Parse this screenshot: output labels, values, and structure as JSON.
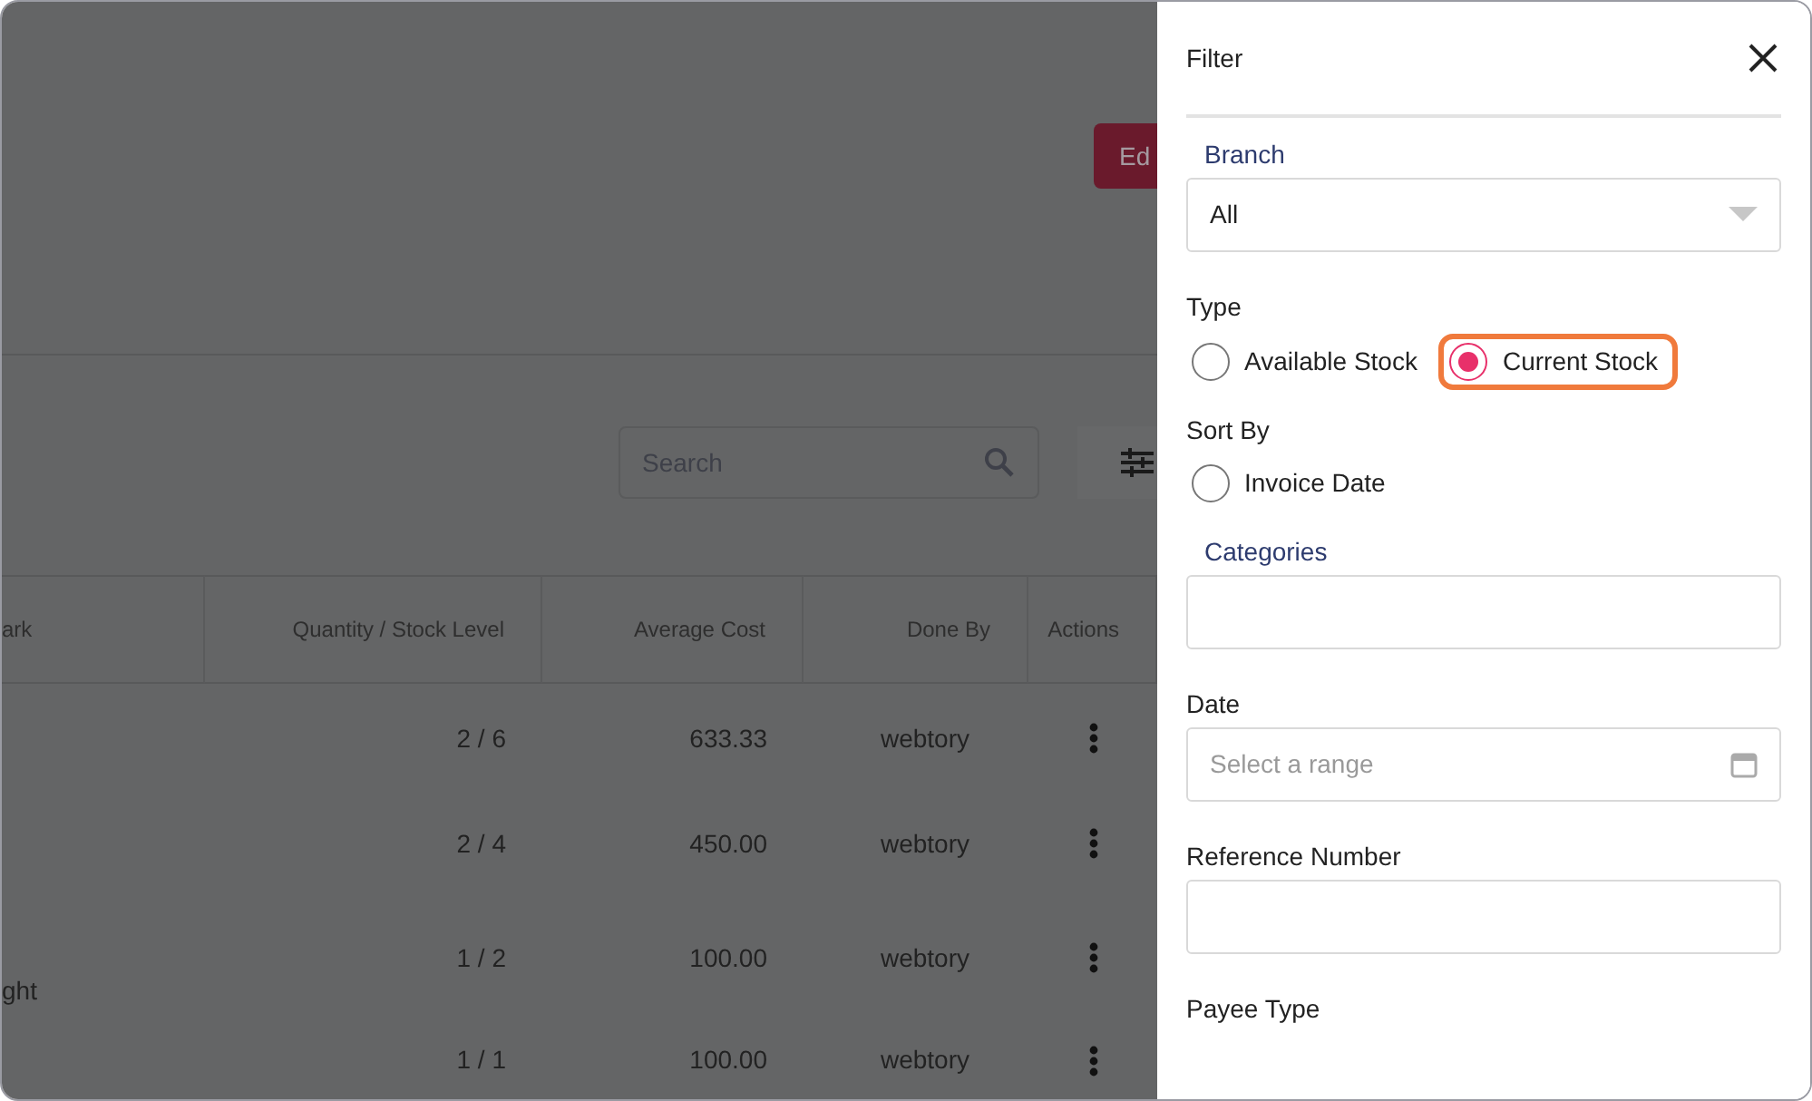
{
  "page": {
    "header_button": "Ed",
    "search": {
      "placeholder": "Search"
    },
    "table": {
      "columns": [
        "ark",
        "Quantity / Stock Level",
        "Average Cost",
        "Done By",
        "Actions"
      ],
      "rows": [
        {
          "column_1": "",
          "quantity": "2 / 6",
          "average_cost": "633.33",
          "done_by": "webtory"
        },
        {
          "column_1": "",
          "quantity": "2 / 4",
          "average_cost": "450.00",
          "done_by": "webtory"
        },
        {
          "column_1": "ght",
          "quantity": "1 / 2",
          "average_cost": "100.00",
          "done_by": "webtory"
        },
        {
          "column_1": "",
          "quantity": "1 / 1",
          "average_cost": "100.00",
          "done_by": "webtory"
        }
      ]
    }
  },
  "filter_panel": {
    "title": "Filter",
    "fields": [
      {
        "kind": "select",
        "label": "Branch",
        "accent_label": true,
        "value": "All"
      },
      {
        "kind": "radio",
        "label": "Type",
        "accent_label": false,
        "options": [
          {
            "label": "Available Stock",
            "selected": false,
            "highlighted": false
          },
          {
            "label": "Current Stock",
            "selected": true,
            "highlighted": true
          }
        ]
      },
      {
        "kind": "radio",
        "label": "Sort By",
        "accent_label": false,
        "options": [
          {
            "label": "Invoice Date",
            "selected": false,
            "highlighted": false
          }
        ]
      },
      {
        "kind": "input",
        "label": "Categories",
        "accent_label": true
      },
      {
        "kind": "date",
        "label": "Date",
        "accent_label": false,
        "placeholder": "Select a range"
      },
      {
        "kind": "input",
        "label": "Reference Number",
        "accent_label": false
      },
      {
        "kind": "label",
        "label": "Payee Type",
        "accent_label": false
      }
    ]
  }
}
